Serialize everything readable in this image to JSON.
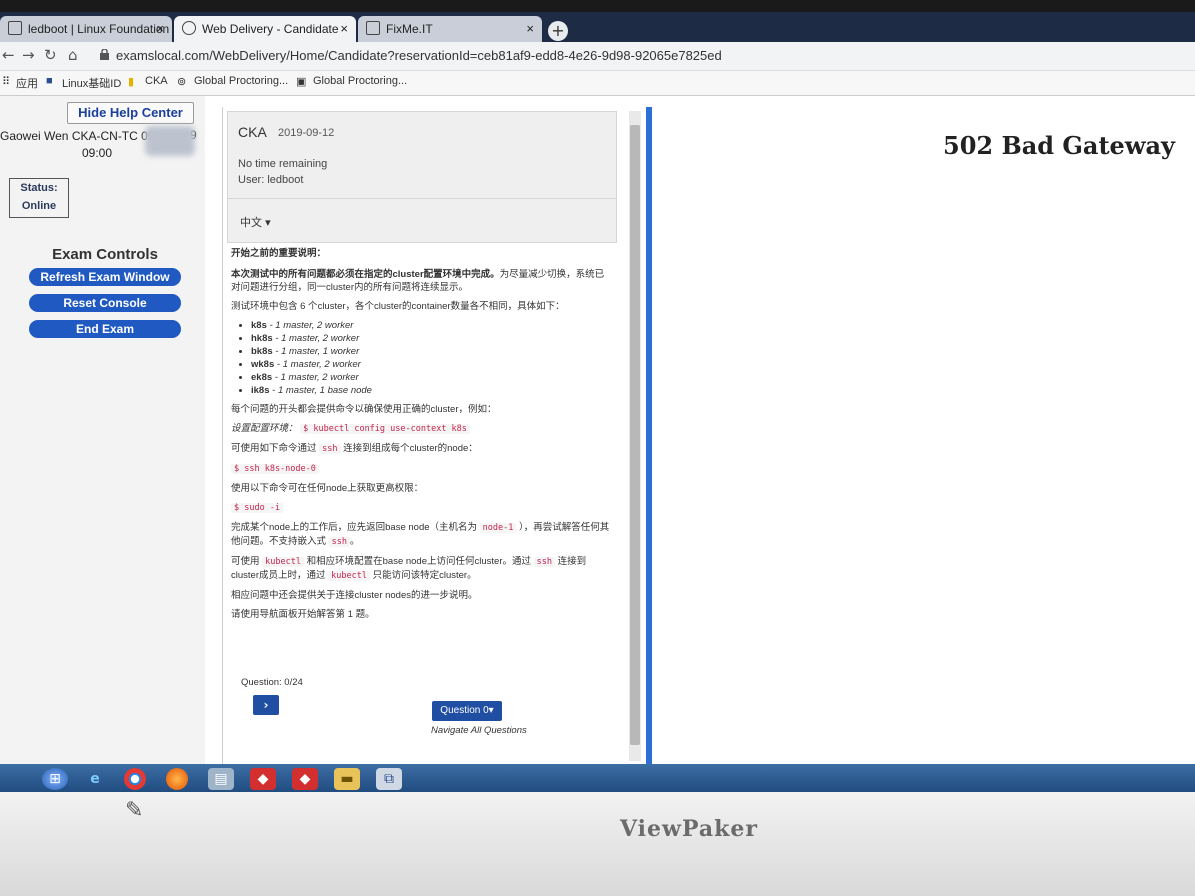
{
  "browser": {
    "tabs": [
      {
        "label": "ledboot | Linux Foundation ID",
        "active": false
      },
      {
        "label": "Web Delivery - Candidate",
        "active": true
      },
      {
        "label": "FixMe.IT",
        "active": false
      }
    ],
    "close_glyph": "×",
    "new_tab_glyph": "+",
    "url": "examslocal.com/WebDelivery/Home/Candidate?reservationId=ceb81af9-edd8-4e26-9d98-92065e7825ed",
    "bookmarks": [
      "应用",
      "Linux基础ID",
      "CKA",
      "Global Proctoring...",
      "Global Proctoring..."
    ]
  },
  "left": {
    "help_button": "Hide Help Center",
    "candidate_line1": "Gaowei Wen CKA-CN-TC 09",
    "candidate_line2": "9",
    "candidate_time": "09:00",
    "status_label": "Status:",
    "status_value": "Online",
    "controls_title": "Exam Controls",
    "buttons": [
      "Refresh Exam Window",
      "Reset Console",
      "End Exam"
    ]
  },
  "exam": {
    "title": "CKA",
    "date": "2019-09-12",
    "time_remaining": "No time remaining",
    "user": "User: ledboot",
    "language": "中文",
    "heading": "开始之前的重要说明：",
    "p1_bold": "本次测试中的所有问题都必须在指定的cluster配置环境中完成。",
    "p1_rest": "为尽量减少切换，系统已对问题进行分组，同一cluster内的所有问题将连续显示。",
    "p2": "测试环境中包含 6 个cluster，各个cluster的container数量各不相同，具体如下：",
    "clusters": [
      {
        "name": "k8s",
        "desc": "- 1 master, 2 worker"
      },
      {
        "name": "hk8s",
        "desc": "- 1 master, 2 worker"
      },
      {
        "name": "bk8s",
        "desc": "- 1 master, 1 worker"
      },
      {
        "name": "wk8s",
        "desc": "- 1 master, 2 worker"
      },
      {
        "name": "ek8s",
        "desc": "- 1 master, 2 worker"
      },
      {
        "name": "ik8s",
        "desc": "- 1 master, 1 base node"
      }
    ],
    "p3": "每个问题的开头都会提供命令以确保使用正确的cluster，例如：",
    "p4_label": "设置配置环境：",
    "p4_code": "$ kubectl config use-context k8s",
    "p5_a": "可使用如下命令通过",
    "p5_code": "ssh",
    "p5_b": "连接到组成每个cluster的node：",
    "p6_code": "$ ssh k8s-node-0",
    "p7": "使用以下命令可在任何node上获取更高权限：",
    "p8_code": "$ sudo -i",
    "p9_a": "完成某个node上的工作后，应先返回base node（主机名为",
    "p9_code": "node-1",
    "p9_b": "），再尝试解答任何其他问题。不支持嵌入式",
    "p9_code2": "ssh",
    "p9_c": "。",
    "p10_a": "可使用",
    "p10_code": "kubectl",
    "p10_b": "和相应环境配置在base node上访问任何cluster。通过",
    "p10_code2": "ssh",
    "p10_c": "连接到cluster成员上时，通过",
    "p10_code3": "kubectl",
    "p10_d": "只能访问该特定cluster。",
    "p11": "相应问题中还会提供关于连接cluster nodes的进一步说明。",
    "p12": "请使用导航面板开始解答第 1 题。",
    "question_count": "Question: 0/24",
    "next_glyph": "›",
    "question_button": "Question 0▾",
    "navigate_all": "Navigate All Questions"
  },
  "right": {
    "error": "502 Bad Gateway"
  },
  "monitor": {
    "brand": "ViewPaker"
  }
}
